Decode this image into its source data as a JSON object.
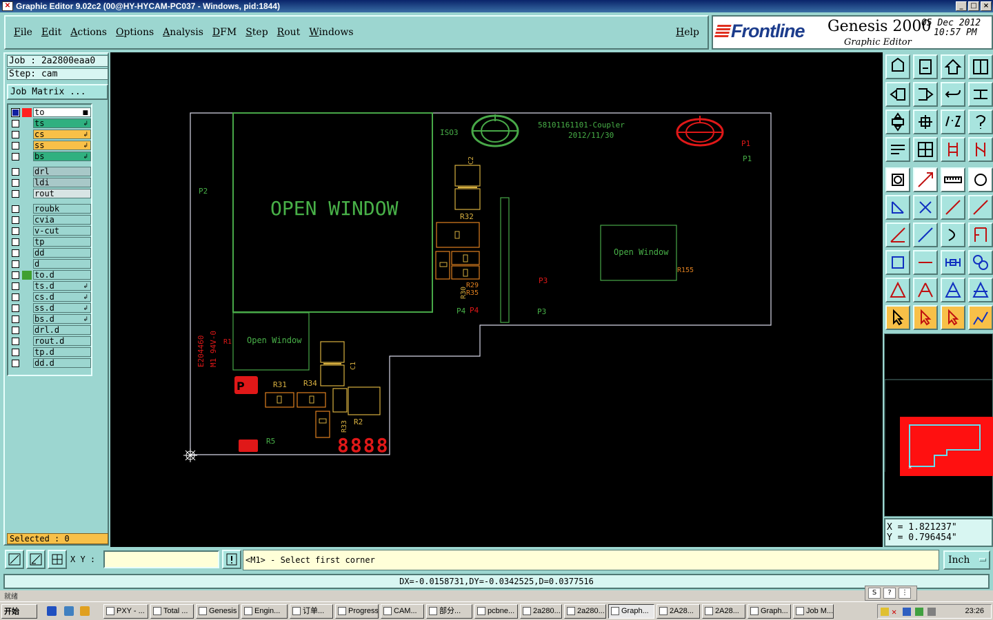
{
  "window": {
    "title": "Graphic Editor 9.02c2 (00@HY-HYCAM-PC037 - Windows, pid:1844)",
    "controls": [
      "_",
      "□",
      "×"
    ]
  },
  "menu": {
    "items": [
      "File",
      "Edit",
      "Actions",
      "Options",
      "Analysis",
      "DFM",
      "Step",
      "Rout",
      "Windows"
    ],
    "help": "Help"
  },
  "brand": {
    "logo": "Frontline",
    "product": "Genesis 2000",
    "subtitle": "Graphic Editor",
    "date": "05 Dec 2012",
    "time": "10:57 PM"
  },
  "job": {
    "job_label": "Job : 2a2800eaa0",
    "step_label": "Step: cam",
    "matrix_button": "Job Matrix ..."
  },
  "layers": [
    {
      "name": "to",
      "color": "#ffffff",
      "swatch": "#ff2020",
      "checked": true,
      "tick": "■"
    },
    {
      "name": "ts",
      "color": "#30b080",
      "swatch": "",
      "checked": false,
      "tick": "↲"
    },
    {
      "name": "cs",
      "color": "#f8c048",
      "swatch": "",
      "checked": false,
      "tick": "↲"
    },
    {
      "name": "ss",
      "color": "#f8c048",
      "swatch": "",
      "checked": false,
      "tick": "↲"
    },
    {
      "name": "bs",
      "color": "#30b080",
      "swatch": "",
      "checked": false,
      "tick": "↲"
    },
    {
      "name": "drl",
      "color": "#a8c8c8",
      "swatch": "",
      "checked": false,
      "tick": ""
    },
    {
      "name": "ldi",
      "color": "#a8c8c8",
      "swatch": "",
      "checked": false,
      "tick": ""
    },
    {
      "name": "rout",
      "color": "#d8e4e4",
      "swatch": "",
      "checked": false,
      "tick": ""
    },
    {
      "name": "roubk",
      "color": "#9cd6d0",
      "swatch": "",
      "checked": false,
      "tick": ""
    },
    {
      "name": "cvia",
      "color": "#9cd6d0",
      "swatch": "",
      "checked": false,
      "tick": ""
    },
    {
      "name": "v-cut",
      "color": "#9cd6d0",
      "swatch": "",
      "checked": false,
      "tick": ""
    },
    {
      "name": "tp",
      "color": "#9cd6d0",
      "swatch": "",
      "checked": false,
      "tick": ""
    },
    {
      "name": "dd",
      "color": "#9cd6d0",
      "swatch": "",
      "checked": false,
      "tick": ""
    },
    {
      "name": "d",
      "color": "#9cd6d0",
      "swatch": "",
      "checked": false,
      "tick": ""
    },
    {
      "name": "to.d",
      "color": "#9cd6d0",
      "swatch": "#40a030",
      "checked": false,
      "tick": ""
    },
    {
      "name": "ts.d",
      "color": "#9cd6d0",
      "swatch": "",
      "checked": false,
      "tick": "↲"
    },
    {
      "name": "cs.d",
      "color": "#9cd6d0",
      "swatch": "",
      "checked": false,
      "tick": "↲"
    },
    {
      "name": "ss.d",
      "color": "#9cd6d0",
      "swatch": "",
      "checked": false,
      "tick": "↲"
    },
    {
      "name": "bs.d",
      "color": "#9cd6d0",
      "swatch": "",
      "checked": false,
      "tick": "↲"
    },
    {
      "name": "drl.d",
      "color": "#9cd6d0",
      "swatch": "",
      "checked": false,
      "tick": ""
    },
    {
      "name": "rout.d",
      "color": "#9cd6d0",
      "swatch": "",
      "checked": false,
      "tick": ""
    },
    {
      "name": "tp.d",
      "color": "#9cd6d0",
      "swatch": "",
      "checked": false,
      "tick": ""
    },
    {
      "name": "dd.d",
      "color": "#9cd6d0",
      "swatch": "",
      "checked": false,
      "tick": ""
    }
  ],
  "selected_label": "Selected : 0",
  "canvas_text": {
    "open_window_big": "OPEN  WINDOW",
    "open_window_small_1": "Open  Window",
    "open_window_small_2": "Open  Window",
    "iso": "ISO3",
    "part_no": "58101161101-Coupler",
    "part_date": "2012/11/30",
    "p1_red": "P1",
    "p1_green": "P1",
    "p2": "P2",
    "p3_red": "P3",
    "p3_green": "P3",
    "p4_green": "P4",
    "p4_red": "P4",
    "c2": "C2",
    "c1": "C1",
    "r32": "R32",
    "r30": "R30",
    "r29": "R29",
    "r35": "R35",
    "r155": "R155",
    "r31": "R31",
    "r34": "R34",
    "r33": "R33",
    "r2": "R2",
    "r5": "R5",
    "r1": "R1",
    "ul_text_1": "E204460",
    "ul_text_2": "M1 94V-0",
    "digits": "8888"
  },
  "coords": {
    "x": "X = 1.821237\"",
    "y": "Y = 0.796454\""
  },
  "bottom": {
    "xy_label": "X Y :",
    "xy_value": "",
    "prompt": "<M1> - Select first corner",
    "units": "Inch",
    "measure": "DX=-0.0158731,DY=-0.0342525,D=0.0377516"
  },
  "tray_label": "就绪",
  "ime_buttons": [
    "S",
    "?",
    "⋮"
  ],
  "taskbar": {
    "start": "开始",
    "tasks": [
      "PXY - ...",
      "Total ...",
      "Genesis",
      "Engin...",
      "订单...",
      "Progress",
      "CAM...",
      "部分...",
      "pcbne...",
      "2a280...",
      "2a280...",
      "Graph...",
      "2A28...",
      "2A28...",
      "Graph...",
      "Job M..."
    ],
    "active_index": 11,
    "clock": "23:26"
  }
}
